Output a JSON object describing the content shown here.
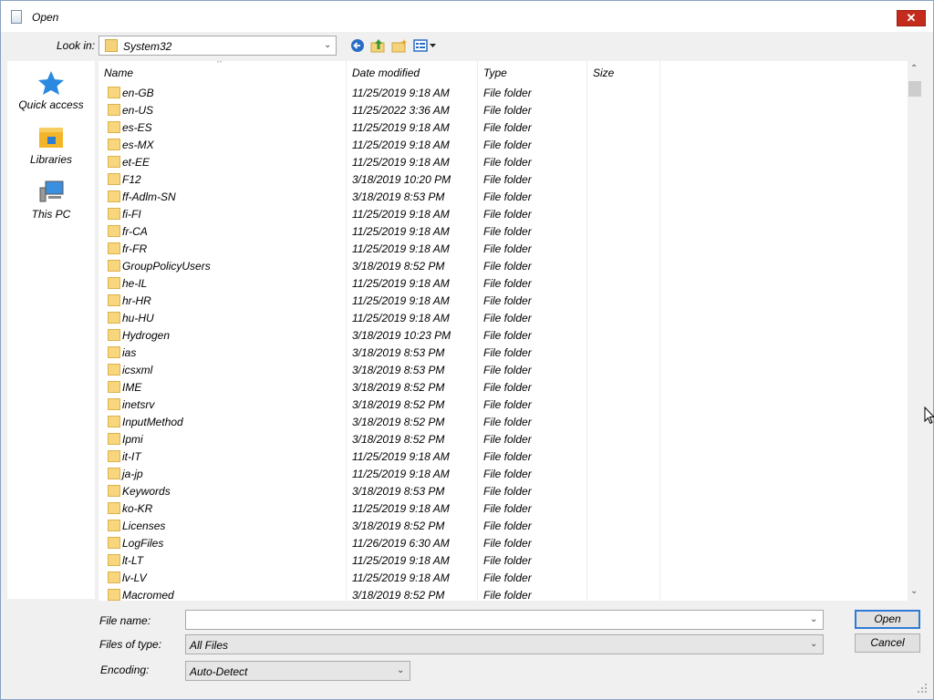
{
  "window": {
    "title": "Open",
    "close_glyph": "✕"
  },
  "toolbar": {
    "look_in_label": "Look in:",
    "look_in_value": "System32",
    "icons": [
      "back-icon",
      "up-folder-icon",
      "new-folder-icon",
      "view-menu-icon"
    ]
  },
  "sidebar": {
    "items": [
      {
        "label": "Quick access",
        "icon": "star-icon"
      },
      {
        "label": "Libraries",
        "icon": "libraries-icon"
      },
      {
        "label": "This PC",
        "icon": "computer-icon"
      }
    ]
  },
  "list": {
    "sort_glyph": "^",
    "columns": [
      "Name",
      "Date modified",
      "Type",
      "Size"
    ],
    "rows": [
      {
        "name": "en-GB",
        "date": "11/25/2019 9:18 AM",
        "type": "File folder"
      },
      {
        "name": "en-US",
        "date": "11/25/2022 3:36 AM",
        "type": "File folder"
      },
      {
        "name": "es-ES",
        "date": "11/25/2019 9:18 AM",
        "type": "File folder"
      },
      {
        "name": "es-MX",
        "date": "11/25/2019 9:18 AM",
        "type": "File folder"
      },
      {
        "name": "et-EE",
        "date": "11/25/2019 9:18 AM",
        "type": "File folder"
      },
      {
        "name": "F12",
        "date": "3/18/2019 10:20 PM",
        "type": "File folder"
      },
      {
        "name": "ff-Adlm-SN",
        "date": "3/18/2019 8:53 PM",
        "type": "File folder"
      },
      {
        "name": "fi-FI",
        "date": "11/25/2019 9:18 AM",
        "type": "File folder"
      },
      {
        "name": "fr-CA",
        "date": "11/25/2019 9:18 AM",
        "type": "File folder"
      },
      {
        "name": "fr-FR",
        "date": "11/25/2019 9:18 AM",
        "type": "File folder"
      },
      {
        "name": "GroupPolicyUsers",
        "date": "3/18/2019 8:52 PM",
        "type": "File folder"
      },
      {
        "name": "he-IL",
        "date": "11/25/2019 9:18 AM",
        "type": "File folder"
      },
      {
        "name": "hr-HR",
        "date": "11/25/2019 9:18 AM",
        "type": "File folder"
      },
      {
        "name": "hu-HU",
        "date": "11/25/2019 9:18 AM",
        "type": "File folder"
      },
      {
        "name": "Hydrogen",
        "date": "3/18/2019 10:23 PM",
        "type": "File folder"
      },
      {
        "name": "ias",
        "date": "3/18/2019 8:53 PM",
        "type": "File folder"
      },
      {
        "name": "icsxml",
        "date": "3/18/2019 8:53 PM",
        "type": "File folder"
      },
      {
        "name": "IME",
        "date": "3/18/2019 8:52 PM",
        "type": "File folder"
      },
      {
        "name": "inetsrv",
        "date": "3/18/2019 8:52 PM",
        "type": "File folder"
      },
      {
        "name": "InputMethod",
        "date": "3/18/2019 8:52 PM",
        "type": "File folder"
      },
      {
        "name": "Ipmi",
        "date": "3/18/2019 8:52 PM",
        "type": "File folder"
      },
      {
        "name": "it-IT",
        "date": "11/25/2019 9:18 AM",
        "type": "File folder"
      },
      {
        "name": "ja-jp",
        "date": "11/25/2019 9:18 AM",
        "type": "File folder"
      },
      {
        "name": "Keywords",
        "date": "3/18/2019 8:53 PM",
        "type": "File folder"
      },
      {
        "name": "ko-KR",
        "date": "11/25/2019 9:18 AM",
        "type": "File folder"
      },
      {
        "name": "Licenses",
        "date": "3/18/2019 8:52 PM",
        "type": "File folder"
      },
      {
        "name": "LogFiles",
        "date": "11/26/2019 6:30 AM",
        "type": "File folder"
      },
      {
        "name": "lt-LT",
        "date": "11/25/2019 9:18 AM",
        "type": "File folder"
      },
      {
        "name": "lv-LV",
        "date": "11/25/2019 9:18 AM",
        "type": "File folder"
      },
      {
        "name": "Macromed",
        "date": "3/18/2019 8:52 PM",
        "type": "File folder"
      }
    ]
  },
  "footer": {
    "file_name_label": "File name:",
    "file_name_value": "",
    "files_of_type_label": "Files of type:",
    "files_of_type_value": "All Files",
    "encoding_label": "Encoding:",
    "encoding_value": "Auto-Detect",
    "open_label": "Open",
    "cancel_label": "Cancel"
  }
}
